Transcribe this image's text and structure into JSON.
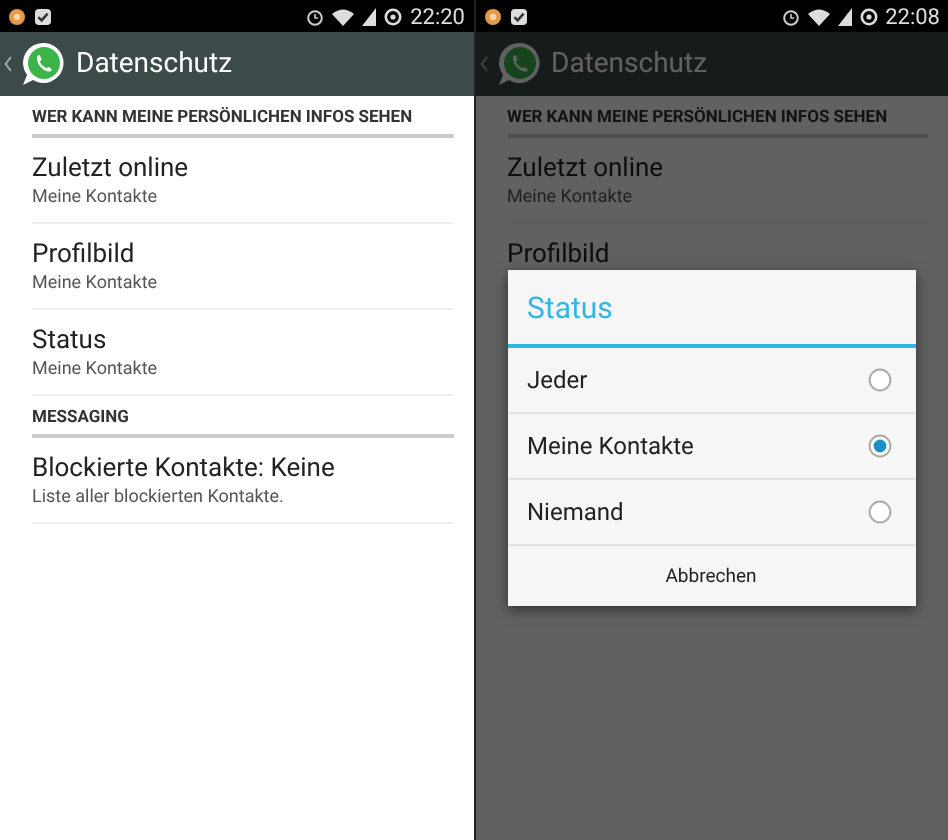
{
  "screens": [
    {
      "status_bar": {
        "time": "22:20"
      },
      "app_bar": {
        "title": "Datenschutz"
      },
      "sections": [
        {
          "header": "WER KANN MEINE PERSÖNLICHEN INFOS SEHEN",
          "items": [
            {
              "title": "Zuletzt online",
              "subtitle": "Meine Kontakte"
            },
            {
              "title": "Profilbild",
              "subtitle": "Meine Kontakte"
            },
            {
              "title": "Status",
              "subtitle": "Meine Kontakte"
            }
          ]
        },
        {
          "header": "MESSAGING",
          "items": [
            {
              "title": "Blockierte Kontakte: Keine",
              "subtitle": "Liste aller blockierten Kontakte."
            }
          ]
        }
      ]
    },
    {
      "status_bar": {
        "time": "22:08"
      },
      "app_bar": {
        "title": "Datenschutz"
      },
      "sections": [
        {
          "header": "WER KANN MEINE PERSÖNLICHEN INFOS SEHEN",
          "items": [
            {
              "title": "Zuletzt online",
              "subtitle": "Meine Kontakte"
            },
            {
              "title": "Profilbild"
            }
          ]
        }
      ],
      "dialog": {
        "title": "Status",
        "options": [
          {
            "label": "Jeder",
            "selected": false
          },
          {
            "label": "Meine Kontakte",
            "selected": true
          },
          {
            "label": "Niemand",
            "selected": false
          }
        ],
        "cancel": "Abbrechen"
      }
    }
  ]
}
